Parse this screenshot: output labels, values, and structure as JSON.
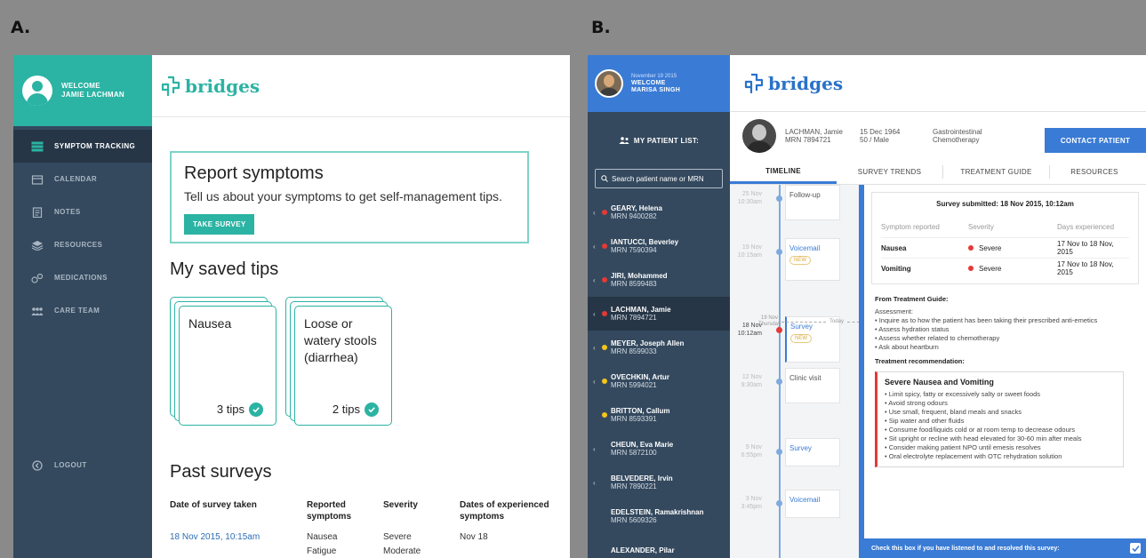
{
  "labels": {
    "a": "A.",
    "b": "B."
  },
  "panelA": {
    "welcome": [
      "WELCOME",
      "JAMIE LACHMAN"
    ],
    "brand": "bridges",
    "nav": [
      {
        "label": "SYMPTOM TRACKING",
        "icon": "list-icon",
        "active": true
      },
      {
        "label": "CALENDAR",
        "icon": "calendar-icon"
      },
      {
        "label": "NOTES",
        "icon": "notes-icon"
      },
      {
        "label": "RESOURCES",
        "icon": "resources-icon"
      },
      {
        "label": "MEDICATIONS",
        "icon": "pills-icon"
      },
      {
        "label": "CARE TEAM",
        "icon": "team-icon"
      }
    ],
    "logout": "LOGOUT",
    "report": {
      "title": "Report symptoms",
      "subtitle": "Tell us about your symptoms to get self-management tips.",
      "button": "TAKE SURVEY"
    },
    "saved_title": "My saved tips",
    "tips": [
      {
        "name": "Nausea",
        "count": "3 tips"
      },
      {
        "name": "Loose or watery stools (diarrhea)",
        "count": "2 tips"
      }
    ],
    "past_title": "Past surveys",
    "table": {
      "headers": [
        "Date of survey taken",
        "Reported symptoms",
        "Severity",
        "Dates of experienced symptoms"
      ],
      "rows": [
        [
          "18 Nov 2015, 10:15am",
          "Nausea",
          "Severe",
          "Nov 18"
        ],
        [
          "",
          "Fatigue",
          "Moderate",
          ""
        ]
      ]
    }
  },
  "panelB": {
    "date": "November 19 2015",
    "welcome": [
      "WELCOME",
      "MARISA SINGH"
    ],
    "brand": "bridges",
    "my_list": "MY PATIENT LIST:",
    "search_placeholder": "Search patient name or MRN",
    "patients": [
      {
        "name": "GEARY, Helena",
        "mrn": "MRN 9400282",
        "dot": "#e53935",
        "phone": true
      },
      {
        "name": "IANTUCCI, Beverley",
        "mrn": "MRN 7590394",
        "dot": "#e53935",
        "phone": true
      },
      {
        "name": "JIRI, Mohammed",
        "mrn": "MRN 8599483",
        "dot": "#e53935",
        "phone": true
      },
      {
        "name": "LACHMAN, Jamie",
        "mrn": "MRN 7894721",
        "dot": "#e53935",
        "phone": true,
        "active": true
      },
      {
        "name": "MEYER, Joseph Allen",
        "mrn": "MRN 8599033",
        "dot": "#f5c518",
        "phone": true
      },
      {
        "name": "OVECHKIN, Artur",
        "mrn": "MRN 5994021",
        "dot": "#f5c518",
        "phone": true
      },
      {
        "name": "BRITTON, Callum",
        "mrn": "MRN 8593391",
        "dot": "#f5c518",
        "phone": false
      },
      {
        "name": "CHEUN, Eva Marie",
        "mrn": "MRN 5872100",
        "dot": "",
        "phone": true
      },
      {
        "name": "BELVEDERE, Irvin",
        "mrn": "MRN 7890221",
        "dot": "",
        "phone": true
      },
      {
        "name": "EDELSTEIN, Ramakrishnan",
        "mrn": "MRN 5609326",
        "dot": "",
        "phone": false
      },
      {
        "name": "ALEXANDER, Pilar",
        "mrn": "",
        "dot": "",
        "phone": false
      }
    ],
    "patient": {
      "name": "LACHMAN, Jamie",
      "mrn": "MRN 7894721",
      "dob": "15 Dec 1964",
      "agesex": "50 / Male",
      "dept": "Gastrointestinal",
      "treat": "Chemotherapy"
    },
    "contact": "CONTACT PATIENT",
    "tabs": [
      "TIMELINE",
      "SURVEY TRENDS",
      "TREATMENT GUIDE",
      "RESOURCES"
    ],
    "timeline": [
      {
        "date": "25 Nov",
        "time": "10:30am",
        "label": "Follow-up"
      },
      {
        "date": "19 Nov",
        "time": "10:15am",
        "label": "Voicemail",
        "new": "NEW"
      },
      {
        "date": "18 Nov",
        "time": "10:12am",
        "label": "Survey",
        "new": "NEW"
      },
      {
        "date": "12 Nov",
        "time": "9:30am",
        "label": "Clinic visit"
      },
      {
        "date": "9 Nov",
        "time": "6:55pm",
        "label": "Survey"
      },
      {
        "date": "3 Nov",
        "time": "3:45pm",
        "label": "Voicemail"
      }
    ],
    "today": {
      "date": "19 Nov",
      "day": "Thursday",
      "label": "Today"
    },
    "survey": {
      "title": "Survey submitted: 18 Nov 2015, 10:12am",
      "headers": [
        "Symptom reported",
        "Severity",
        "Days experienced"
      ],
      "rows": [
        [
          "Nausea",
          "Severe",
          "17 Nov to 18 Nov, 2015"
        ],
        [
          "Vomiting",
          "Severe",
          "17 Nov to 18 Nov, 2015"
        ]
      ]
    },
    "guide": {
      "title": "From Treatment Guide:",
      "assessment": "Assessment:",
      "items": [
        "• Inquire as to how the patient has been taking their prescribed anti-emetics",
        "• Assess hydration status",
        "• Assess whether related to chemotherapy",
        "• Ask about heartburn"
      ],
      "rec_title": "Treatment recommendation:",
      "rec_heading": "Severe Nausea and Vomiting",
      "rec_items": [
        "• Limit spicy, fatty or excessively salty or sweet foods",
        "• Avoid strong odours",
        "• Use small, frequent, bland meals and snacks",
        "• Sip water and other fluids",
        "• Consume food/liquids cold or at room temp to decrease odours",
        "• Sit upright or recline with head elevated for 30-60 min after meals",
        "• Consider making patient NPO until emesis resolves",
        "• Oral electrolyte replacement with OTC rehydration solution"
      ]
    },
    "confirm": "Check this box if you have listened to and resolved this survey:"
  }
}
